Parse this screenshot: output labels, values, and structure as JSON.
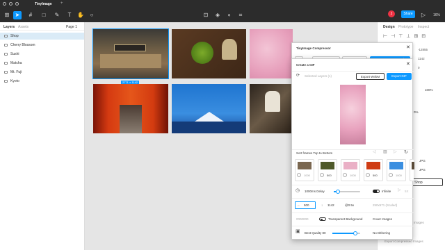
{
  "app": {
    "title": "TinyImage"
  },
  "toolbar": {
    "share_label": "Share",
    "zoom": "16%",
    "avatar_initial": "J"
  },
  "layers_panel": {
    "tab_layers": "Layers",
    "tab_assets": "Assets",
    "page": "Page 1",
    "items": [
      {
        "label": "Shop"
      },
      {
        "label": "Cherry Blossom"
      },
      {
        "label": "Sushi"
      },
      {
        "label": "Matcha"
      },
      {
        "label": "Mt. Fuji"
      },
      {
        "label": "Kyoto"
      }
    ]
  },
  "canvas": {
    "size_badge": "2771 × 1142"
  },
  "right_panel": {
    "tab_design": "Design",
    "tab_prototype": "Prototype",
    "tab_inspect": "Inspect",
    "y_value": "-12855",
    "h_value": "1142",
    "r_value": "0",
    "opacity": "100%",
    "opacity2": "0%",
    "fmt1": "JPG",
    "fmt2": "JPG",
    "shop_btn": "Shop",
    "images_text": "Images",
    "export_text": "Export Compressed Images"
  },
  "plugin": {
    "title": "TinyImage Compressor",
    "btn_abbr": "IS",
    "btn_png": "Create a PNG",
    "btn_gif": "Create a GIF",
    "btn_export": "Export Compressed"
  },
  "gif_modal": {
    "title": "Create a GIF",
    "selected_layers": "Selected Layers (1)",
    "export_webm": "Export WebM",
    "export_gif": "Export GIF",
    "sort_label": "Sort frames Top to Bottom",
    "frames": [
      {
        "value": "1000"
      },
      {
        "value": "500"
      },
      {
        "value": "1000"
      },
      {
        "value": "500"
      },
      {
        "value": "1000"
      },
      {
        "value": "500"
      }
    ],
    "delay_label": "1000ms Delay",
    "infinite_label": "Infinite",
    "speed_label": "5X",
    "width": "500",
    "height": "1142",
    "scale": "@0.5x",
    "scaled_dims": "250x571 (Scaled)",
    "hex_placeholder": "#000000",
    "transparent_label": "Transparent Background",
    "cover_label": "Cover Images",
    "quality_label": "Best Quality 80",
    "dither_label": "No Dithering"
  }
}
